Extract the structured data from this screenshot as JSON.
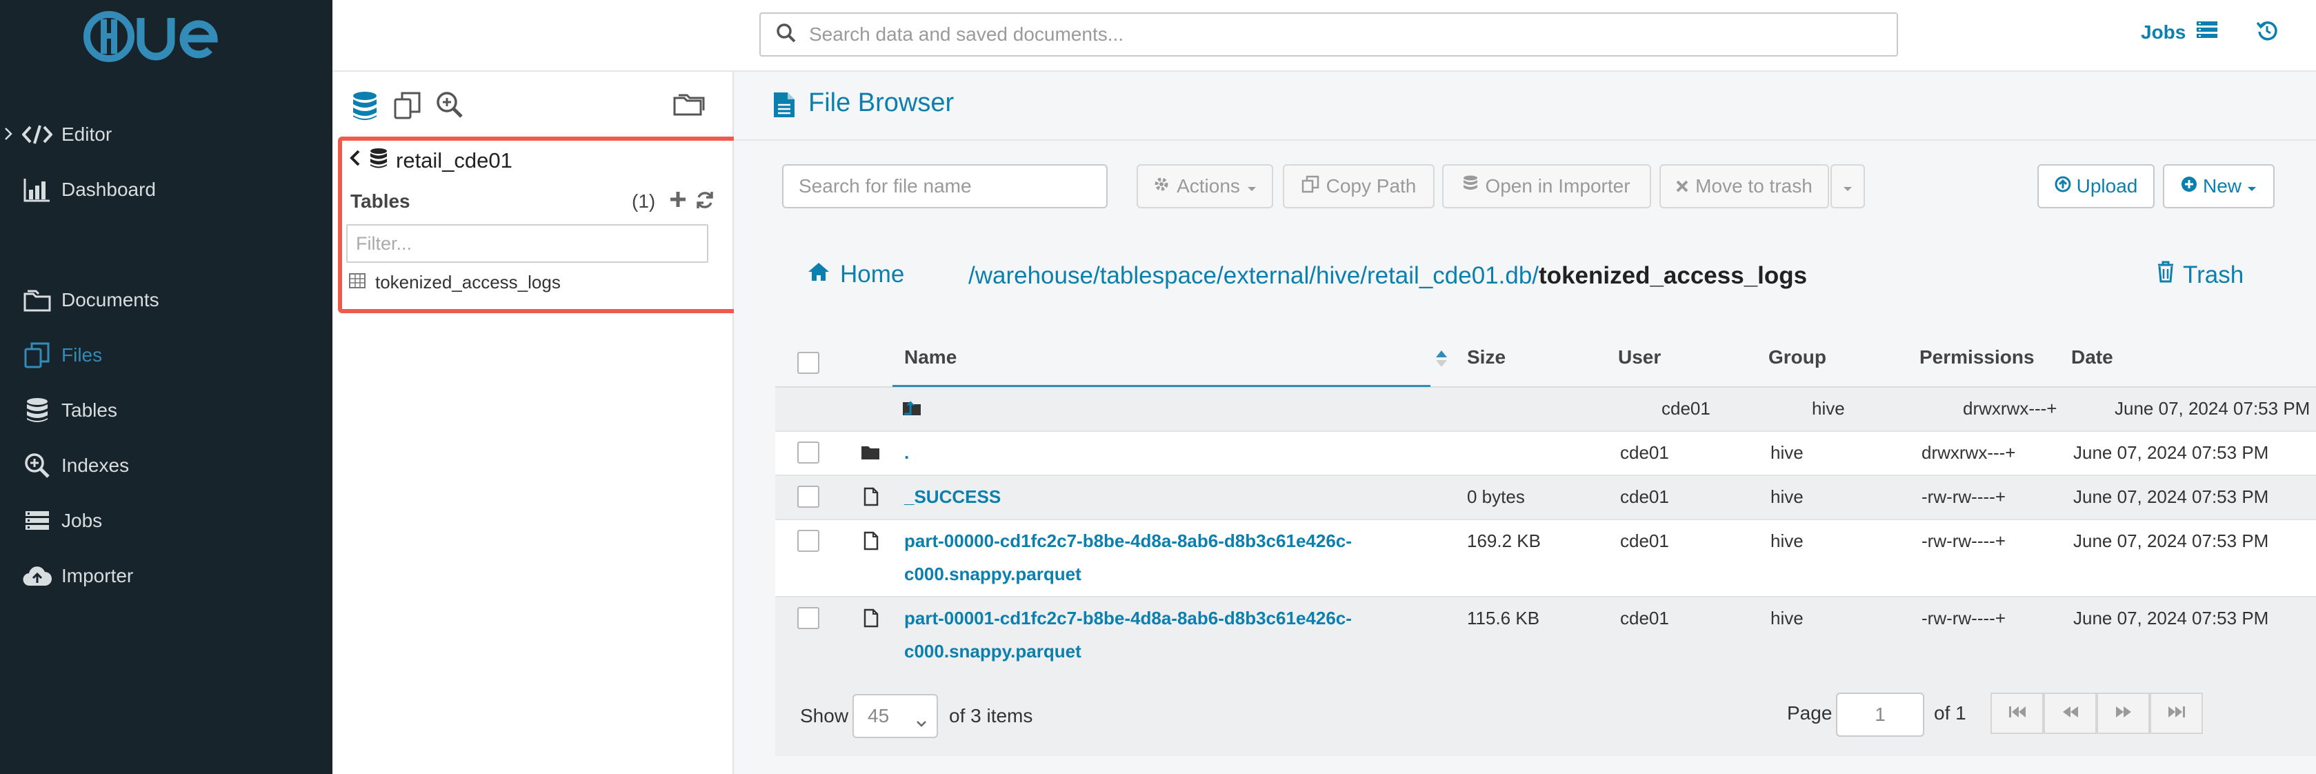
{
  "app": {
    "logo_text": "HUE"
  },
  "nav": {
    "items": [
      {
        "label": "Editor",
        "icon": "code-icon"
      },
      {
        "label": "Dashboard",
        "icon": "bar-chart-icon"
      },
      {
        "label": "Documents",
        "icon": "documents-icon"
      },
      {
        "label": "Files",
        "icon": "files-icon",
        "active": true
      },
      {
        "label": "Tables",
        "icon": "database-icon"
      },
      {
        "label": "Indexes",
        "icon": "search-plus-icon"
      },
      {
        "label": "Jobs",
        "icon": "jobs-icon"
      },
      {
        "label": "Importer",
        "icon": "cloud-upload-icon"
      }
    ]
  },
  "topbar": {
    "search_placeholder": "Search data and saved documents...",
    "jobs_label": "Jobs"
  },
  "assist": {
    "database": "retail_cde01",
    "tables_title": "Tables",
    "tables_count": "(1)",
    "filter_placeholder": "Filter...",
    "tables": [
      "tokenized_access_logs"
    ]
  },
  "main": {
    "title": "File Browser",
    "search_placeholder": "Search for file name",
    "actions_label": "Actions",
    "copy_path_label": "Copy Path",
    "open_importer_label": "Open in Importer",
    "move_trash_label": "Move to trash",
    "upload_label": "Upload",
    "new_label": "New",
    "home_label": "Home",
    "trash_label": "Trash",
    "breadcrumb": [
      "warehouse",
      "tablespace",
      "external",
      "hive",
      "retail_cde01.db"
    ],
    "breadcrumb_current": "tokenized_access_logs",
    "columns": [
      "Name",
      "Size",
      "User",
      "Group",
      "Permissions",
      "Date"
    ],
    "rows": [
      {
        "name": "⮥",
        "size": "",
        "user": "cde01",
        "group": "hive",
        "permissions": "drwxrwx---+",
        "date": "June 07, 2024 07:53 PM",
        "type": "folder"
      },
      {
        "name": ".",
        "size": "",
        "user": "cde01",
        "group": "hive",
        "permissions": "drwxrwx---+",
        "date": "June 07, 2024 07:53 PM",
        "type": "folder"
      },
      {
        "name": "_SUCCESS",
        "size": "0 bytes",
        "user": "cde01",
        "group": "hive",
        "permissions": "-rw-rw----+",
        "date": "June 07, 2024 07:53 PM",
        "type": "file"
      },
      {
        "name_line1": "part-00000-cd1fc2c7-b8be-4d8a-8ab6-d8b3c61e426c-",
        "name_line2": "c000.snappy.parquet",
        "size": "169.2 KB",
        "user": "cde01",
        "group": "hive",
        "permissions": "-rw-rw----+",
        "date": "June 07, 2024 07:53 PM",
        "type": "file"
      },
      {
        "name_line1": "part-00001-cd1fc2c7-b8be-4d8a-8ab6-d8b3c61e426c-",
        "name_line2": "c000.snappy.parquet",
        "size": "115.6 KB",
        "user": "cde01",
        "group": "hive",
        "permissions": "-rw-rw----+",
        "date": "June 07, 2024 07:53 PM",
        "type": "file"
      }
    ],
    "footer": {
      "show_label": "Show",
      "page_size": "45",
      "items_label": "of 3 items",
      "page_label": "Page",
      "page_value": "1",
      "of_pages": "of 1"
    }
  },
  "colors": {
    "nav_bg": "#17242c",
    "accent": "#0b7fad",
    "highlight": "#ee5b4d"
  }
}
